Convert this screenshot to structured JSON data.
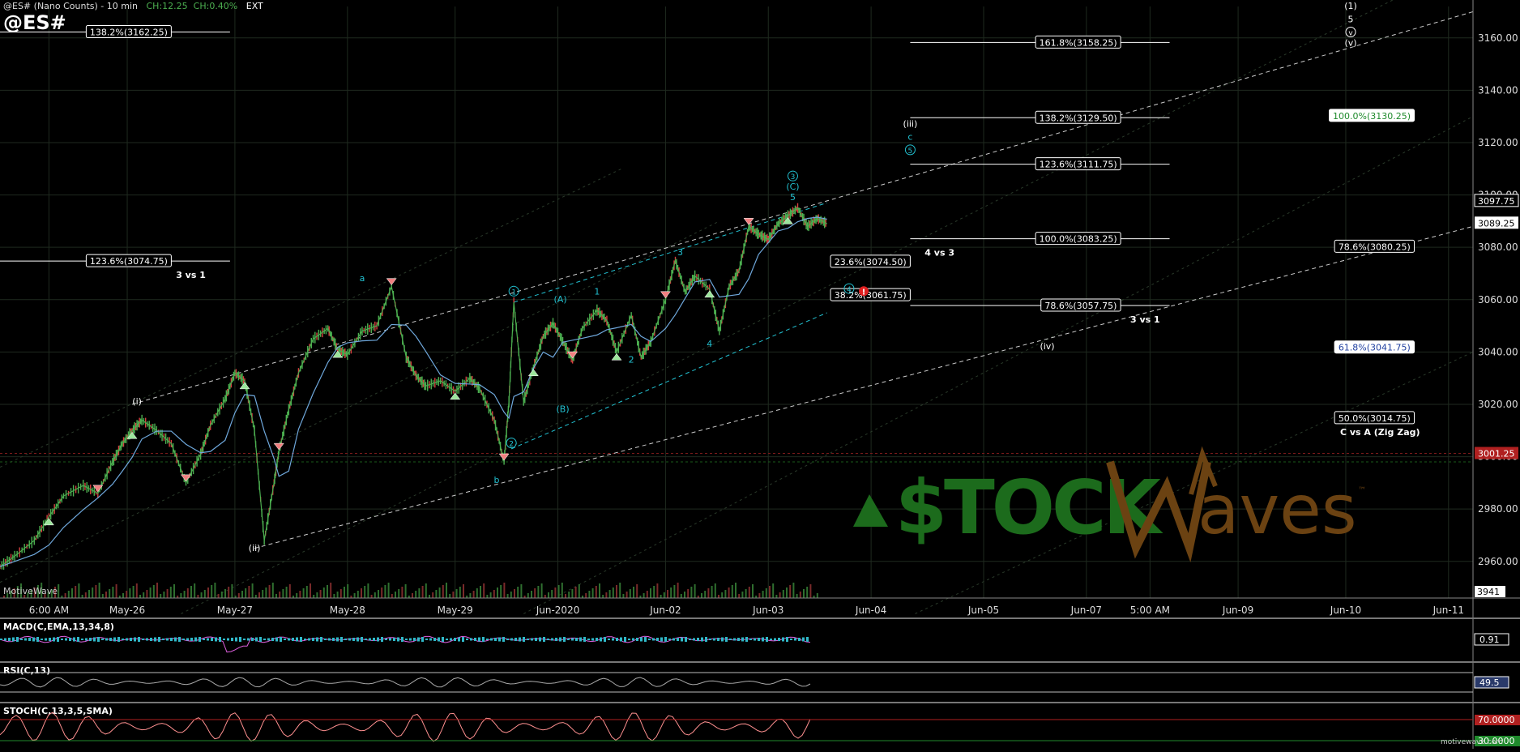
{
  "header": {
    "symbol_line": "@ES# (Nano Counts) - 10 min",
    "change": "CH:12.25",
    "change_pct": "CH:0.40%",
    "session": "EXT",
    "big_symbol": "@ES#",
    "platform": "MotiveWave",
    "footer_brand": "motivewave.com"
  },
  "colors": {
    "background": "#000000",
    "grid": "#1f2a1f",
    "price_up": "#4caf50",
    "price_down": "#d84040",
    "ma_line": "#6fa8dc",
    "wave_cyan": "#22c0d0",
    "fib_label_bg": "#ffffff",
    "fib_label_green": "#1f8a2c",
    "fib_label_blue": "#2040a0",
    "current_price_bg": "#ffffff",
    "last_price_red": "#b02020",
    "watermark_green": "#1c6b1c",
    "watermark_brown": "#6b4212",
    "macd_line": "#e060e0",
    "macd_hist": "#30b8c8",
    "osc_line": "#aaaaaa",
    "stoch_upper": "#b02020",
    "stoch_lower": "#1f8a2c"
  },
  "chart_data": [
    {
      "type": "line",
      "title": "@ES# (Nano Counts) - 10 min",
      "ylim": [
        2946,
        3172
      ],
      "yticks": [
        2960,
        2980,
        3000,
        3020,
        3040,
        3060,
        3080,
        3100,
        3120,
        3140,
        3160
      ],
      "ytick_labels": [
        "2960.00",
        "2980.00",
        "3000.00",
        "3020.00",
        "3040.00",
        "3060.00",
        "3080.00",
        "3100.00",
        "3120.00",
        "3140.00",
        "3160.00"
      ],
      "x_labels": [
        "6:00 AM",
        "May-26",
        "May-27",
        "May-28",
        "May-29",
        "Jun-2020",
        "Jun-02",
        "Jun-03",
        "Jun-04",
        "Jun-05",
        "Jun-07",
        "5:00 AM",
        "Jun-09",
        "Jun-10",
        "Jun-11"
      ],
      "x_label_pos": [
        0.3,
        1.9,
        4.1,
        6.4,
        8.6,
        10.7,
        12.9,
        15.0,
        17.1,
        19.4,
        21.5,
        22.8,
        24.6,
        26.8,
        28.9
      ],
      "xlim": [
        -0.7,
        29.4
      ],
      "series": [
        {
          "x": [
            -0.7,
            -0.4,
            0,
            0.3,
            0.6,
            1.0,
            1.3,
            1.6,
            1.8,
            2.0,
            2.2,
            2.5,
            2.8,
            3.1,
            3.4,
            3.6,
            3.9,
            4.1,
            4.3,
            4.5,
            4.7,
            4.9,
            5.0,
            5.2,
            5.4,
            5.7,
            6.0,
            6.2,
            6.4,
            6.7,
            7.0,
            7.3,
            7.6,
            7.8,
            8.0,
            8.3,
            8.6,
            8.9,
            9.1,
            9.4,
            9.6,
            9.7,
            9.8,
            10.0,
            10.2,
            10.4,
            10.6,
            10.8,
            11.0,
            11.2,
            11.5,
            11.7,
            11.9,
            12.2,
            12.4,
            12.6,
            12.9,
            13.1,
            13.3,
            13.5,
            13.8,
            14.0,
            14.2,
            14.4,
            14.6,
            14.8,
            15.0,
            15.2,
            15.4,
            15.6,
            15.8,
            16.0,
            16.2
          ],
          "values": [
            2958,
            2962,
            2968,
            2977,
            2985,
            2989,
            2986,
            2998,
            3005,
            3010,
            3014,
            3010,
            3005,
            2990,
            3001,
            3012,
            3022,
            3032,
            3029,
            3010,
            2968,
            2990,
            3002,
            3018,
            3032,
            3045,
            3049,
            3041,
            3039,
            3048,
            3050,
            3065,
            3038,
            3031,
            3027,
            3029,
            3025,
            3030,
            3026,
            3014,
            2998,
            3021,
            3059,
            3021,
            3034,
            3046,
            3051,
            3044,
            3037,
            3049,
            3056,
            3052,
            3040,
            3054,
            3038,
            3044,
            3060,
            3075,
            3063,
            3069,
            3064,
            3048,
            3065,
            3071,
            3088,
            3085,
            3083,
            3089,
            3092,
            3095,
            3088,
            3091,
            3089
          ]
        }
      ],
      "current_price": "3097.75",
      "last_price": "3089.25",
      "wave_labels": [
        {
          "text": "(i)",
          "x": 2.1,
          "y": 3020,
          "color": "white"
        },
        {
          "text": "(ii)",
          "x": 4.5,
          "y": 2964,
          "color": "white"
        },
        {
          "text": "a",
          "x": 6.7,
          "y": 3067,
          "color": "cyan"
        },
        {
          "text": "b",
          "x": 9.45,
          "y": 2990,
          "color": "cyan"
        },
        {
          "text": "1",
          "x": 9.8,
          "y": 3062,
          "color": "cyan",
          "circle": true
        },
        {
          "text": "2",
          "x": 9.75,
          "y": 3004,
          "color": "cyan",
          "circle": true
        },
        {
          "text": "(A)",
          "x": 10.75,
          "y": 3059,
          "color": "cyan"
        },
        {
          "text": "(B)",
          "x": 10.8,
          "y": 3017,
          "color": "cyan"
        },
        {
          "text": "1",
          "x": 11.5,
          "y": 3062,
          "color": "cyan"
        },
        {
          "text": "2",
          "x": 12.2,
          "y": 3036,
          "color": "cyan"
        },
        {
          "text": "3",
          "x": 13.2,
          "y": 3077,
          "color": "cyan"
        },
        {
          "text": "4",
          "x": 13.8,
          "y": 3042,
          "color": "cyan"
        },
        {
          "text": "5",
          "x": 15.5,
          "y": 3098,
          "color": "cyan"
        },
        {
          "text": "(C)",
          "x": 15.5,
          "y": 3102,
          "color": "cyan"
        },
        {
          "text": "3",
          "x": 15.5,
          "y": 3106,
          "color": "cyan",
          "circle": true
        },
        {
          "text": "4",
          "x": 16.65,
          "y": 3063,
          "color": "cyan",
          "circle": true
        },
        {
          "text": "(iii)",
          "x": 17.9,
          "y": 3126,
          "color": "white"
        },
        {
          "text": "c",
          "x": 17.9,
          "y": 3121,
          "color": "cyan"
        },
        {
          "text": "5",
          "x": 17.9,
          "y": 3116,
          "color": "cyan",
          "circle": true
        },
        {
          "text": "(iv)",
          "x": 20.7,
          "y": 3041,
          "color": "white"
        },
        {
          "text": "(1)",
          "x": 26.9,
          "y": 3171,
          "color": "white"
        },
        {
          "text": "5",
          "x": 26.9,
          "y": 3166,
          "color": "white"
        },
        {
          "text": "v",
          "x": 26.9,
          "y": 3161,
          "color": "white",
          "circle": true
        },
        {
          "text": "(v)",
          "x": 26.9,
          "y": 3157,
          "color": "white"
        }
      ],
      "fib_levels": [
        {
          "label": "138.2%(3162.25)",
          "y": 3162.25,
          "x0": -0.7,
          "x1": 4.0,
          "lx": 2.8,
          "style": "white"
        },
        {
          "label": "123.6%(3074.75)",
          "y": 3074.75,
          "x0": -0.7,
          "x1": 4.0,
          "lx": 2.8,
          "style": "white",
          "note": "3 vs 1",
          "note_x": 3.2
        },
        {
          "label": "161.8%(3158.25)",
          "y": 3158.25,
          "x0": 17.9,
          "x1": 23.2,
          "lx": 22.2,
          "style": "white"
        },
        {
          "label": "138.2%(3129.50)",
          "y": 3129.5,
          "x0": 17.9,
          "x1": 23.2,
          "lx": 22.2,
          "style": "white"
        },
        {
          "label": "123.6%(3111.75)",
          "y": 3111.75,
          "x0": 17.9,
          "x1": 23.2,
          "lx": 22.2,
          "style": "white"
        },
        {
          "label": "100.0%(3083.25)",
          "y": 3083.25,
          "x0": 17.9,
          "x1": 23.2,
          "lx": 22.2,
          "style": "white",
          "note": "4 vs 3",
          "note_x": 18.5
        },
        {
          "label": "78.6%(3057.75)",
          "y": 3057.75,
          "x0": 17.9,
          "x1": 23.2,
          "lx": 22.2,
          "style": "white",
          "note": "3 vs 1",
          "note_x": 22.7
        },
        {
          "label": "23.6%(3074.50)",
          "y": 3074.5,
          "x0": 16.8,
          "x1": 17.6,
          "lx": 17.9,
          "style": "white"
        },
        {
          "label": "38.2%(3061.75)",
          "y": 3061.75,
          "x0": 16.8,
          "x1": 17.6,
          "lx": 17.9,
          "style": "white"
        },
        {
          "label": "100.0%(3130.25)",
          "y": 3130.25,
          "x0": null,
          "x1": null,
          "lx": 28.2,
          "style": "green"
        },
        {
          "label": "78.6%(3080.25)",
          "y": 3080.25,
          "x0": null,
          "x1": null,
          "lx": 28.2,
          "style": "white"
        },
        {
          "label": "61.8%(3041.75)",
          "y": 3041.75,
          "x0": null,
          "x1": null,
          "lx": 28.2,
          "style": "blue"
        },
        {
          "label": "50.0%(3014.75)",
          "y": 3014.75,
          "x0": null,
          "x1": null,
          "lx": 28.2,
          "style": "white",
          "note": "C vs A (Zig Zag)",
          "note_x": 27.5
        }
      ],
      "right_axis_extra": {
        "last_value": "3001.25",
        "volume_value": "3941"
      }
    },
    {
      "type": "line",
      "title": "MACD(C,EMA,13,34,8)",
      "value_label": "0.91"
    },
    {
      "type": "line",
      "title": "RSI(C,13)",
      "value_label": "49.5"
    },
    {
      "type": "line",
      "title": "STOCH(C,13,3,5,SMA)",
      "upper_label": "70.0000",
      "lower_label": "30.0000"
    }
  ]
}
